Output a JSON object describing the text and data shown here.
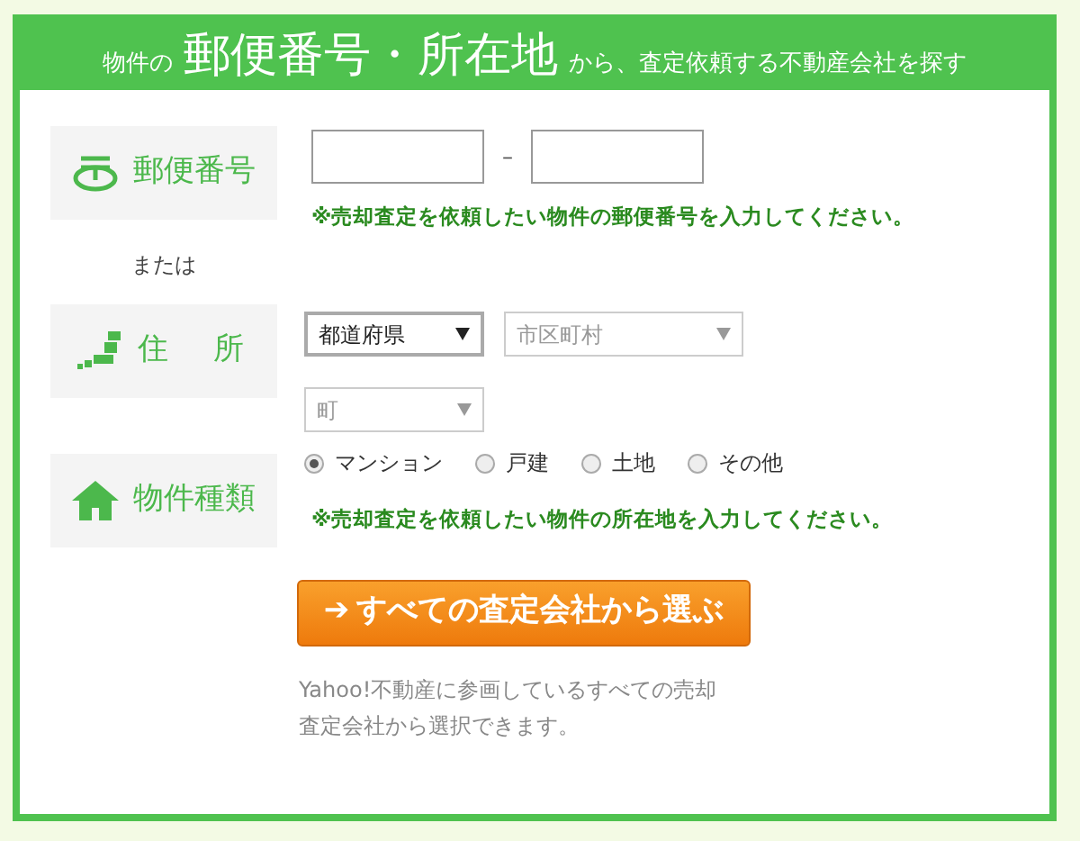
{
  "header": {
    "segments": [
      {
        "text": "物件の",
        "kind": "small"
      },
      {
        "text": "郵便番号・所在地",
        "kind": "large"
      },
      {
        "text": "から、査定依頼する不動産会社を探す",
        "kind": "small"
      }
    ]
  },
  "postal": {
    "label": "郵便番号",
    "separator": "–",
    "note": "※売却査定を依頼したい物件の郵便番号を入力してください。"
  },
  "or_text": "または",
  "address": {
    "label": "住　所",
    "selects": [
      {
        "value": "都道府県",
        "disabled": false
      },
      {
        "value": "市区町村",
        "disabled": true
      },
      {
        "value": "町",
        "disabled": true
      }
    ]
  },
  "property_type": {
    "label": "物件種類",
    "options": [
      {
        "label": "マンション",
        "selected": true
      },
      {
        "label": "戸建",
        "selected": false
      },
      {
        "label": "土地",
        "selected": false
      },
      {
        "label": "その他",
        "selected": false
      }
    ],
    "note": "※売却査定を依頼したい物件の所在地を入力してください。"
  },
  "submit": {
    "arrow": "➔",
    "label": "すべての査定会社から選ぶ"
  },
  "description": "Yahoo!不動産に参画しているすべての売却査定会社から選択できます。"
}
